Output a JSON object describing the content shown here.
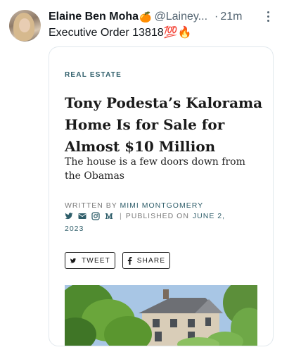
{
  "tweet": {
    "display_name": "Elaine Ben Moha",
    "name_emoji": "🍊",
    "handle": "@Lainey...",
    "separator": "·",
    "time": "21m",
    "text": "Executive Order 13818",
    "text_emojis": "💯🔥"
  },
  "card": {
    "category": "REAL ESTATE",
    "headline": "Tony Podesta’s Kalorama Home Is for Sale for Almost $10 Million",
    "dek": "The house is a few doors down from the Obamas",
    "written_by": "WRITTEN BY",
    "author": "MIMI MONTGOMERY",
    "separator": "|",
    "published_on": "PUBLISHED ON",
    "published_date": "JUNE 2,",
    "published_year": "2023",
    "buttons": {
      "tweet": "TWEET",
      "share": "SHARE"
    }
  },
  "icons": {
    "more": "more-icon",
    "twitter": "twitter-icon",
    "email": "email-icon",
    "instagram": "instagram-icon",
    "medium": "medium-icon",
    "facebook": "facebook-icon"
  },
  "colors": {
    "accent": "#2f5e6a",
    "text": "#0f1419",
    "secondary": "#536471"
  }
}
